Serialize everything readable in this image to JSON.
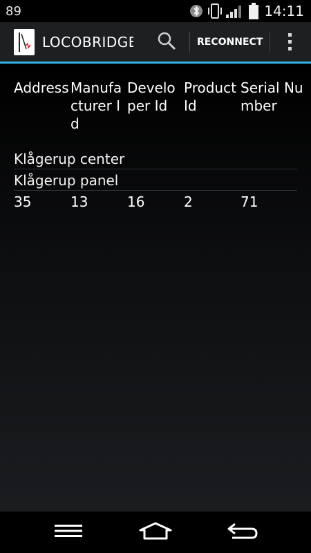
{
  "status_bar": {
    "notification_count": "89",
    "time": "14:11"
  },
  "action_bar": {
    "app_title": "LOCOBRIDGE",
    "reconnect_label": "RECONNECT"
  },
  "table": {
    "headers": [
      "Address",
      "Manufacturer Id",
      "Developer Id",
      "Product Id",
      "Serial Number"
    ],
    "groups": [
      "Klågerup center",
      "Klågerup panel"
    ],
    "rows": [
      [
        "35",
        "13",
        "16",
        "2",
        "71"
      ]
    ]
  },
  "colors": {
    "accent": "#33b5e5",
    "action_bar": "#1d1f21"
  },
  "icons": {
    "bluetooth": "bluetooth-icon",
    "vibrate": "vibrate-icon",
    "signal": "signal-icon",
    "battery": "battery-icon",
    "search": "search-icon",
    "overflow": "overflow-menu-icon",
    "menu": "menu-icon",
    "home": "home-icon",
    "back": "back-icon"
  }
}
